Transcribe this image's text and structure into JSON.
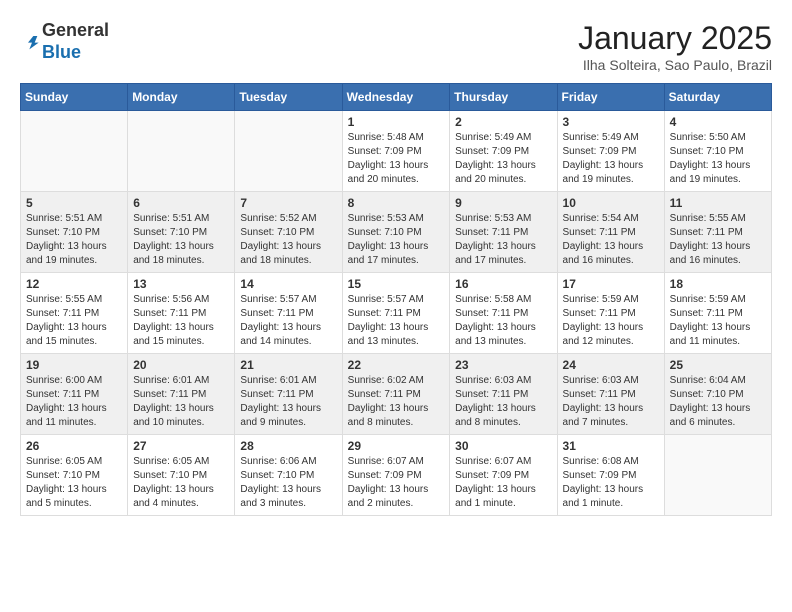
{
  "logo": {
    "general": "General",
    "blue": "Blue"
  },
  "title": "January 2025",
  "subtitle": "Ilha Solteira, Sao Paulo, Brazil",
  "days_of_week": [
    "Sunday",
    "Monday",
    "Tuesday",
    "Wednesday",
    "Thursday",
    "Friday",
    "Saturday"
  ],
  "weeks": [
    {
      "shade": false,
      "days": [
        {
          "number": "",
          "info": ""
        },
        {
          "number": "",
          "info": ""
        },
        {
          "number": "",
          "info": ""
        },
        {
          "number": "1",
          "info": "Sunrise: 5:48 AM\nSunset: 7:09 PM\nDaylight: 13 hours and 20 minutes."
        },
        {
          "number": "2",
          "info": "Sunrise: 5:49 AM\nSunset: 7:09 PM\nDaylight: 13 hours and 20 minutes."
        },
        {
          "number": "3",
          "info": "Sunrise: 5:49 AM\nSunset: 7:09 PM\nDaylight: 13 hours and 19 minutes."
        },
        {
          "number": "4",
          "info": "Sunrise: 5:50 AM\nSunset: 7:10 PM\nDaylight: 13 hours and 19 minutes."
        }
      ]
    },
    {
      "shade": true,
      "days": [
        {
          "number": "5",
          "info": "Sunrise: 5:51 AM\nSunset: 7:10 PM\nDaylight: 13 hours and 19 minutes."
        },
        {
          "number": "6",
          "info": "Sunrise: 5:51 AM\nSunset: 7:10 PM\nDaylight: 13 hours and 18 minutes."
        },
        {
          "number": "7",
          "info": "Sunrise: 5:52 AM\nSunset: 7:10 PM\nDaylight: 13 hours and 18 minutes."
        },
        {
          "number": "8",
          "info": "Sunrise: 5:53 AM\nSunset: 7:10 PM\nDaylight: 13 hours and 17 minutes."
        },
        {
          "number": "9",
          "info": "Sunrise: 5:53 AM\nSunset: 7:11 PM\nDaylight: 13 hours and 17 minutes."
        },
        {
          "number": "10",
          "info": "Sunrise: 5:54 AM\nSunset: 7:11 PM\nDaylight: 13 hours and 16 minutes."
        },
        {
          "number": "11",
          "info": "Sunrise: 5:55 AM\nSunset: 7:11 PM\nDaylight: 13 hours and 16 minutes."
        }
      ]
    },
    {
      "shade": false,
      "days": [
        {
          "number": "12",
          "info": "Sunrise: 5:55 AM\nSunset: 7:11 PM\nDaylight: 13 hours and 15 minutes."
        },
        {
          "number": "13",
          "info": "Sunrise: 5:56 AM\nSunset: 7:11 PM\nDaylight: 13 hours and 15 minutes."
        },
        {
          "number": "14",
          "info": "Sunrise: 5:57 AM\nSunset: 7:11 PM\nDaylight: 13 hours and 14 minutes."
        },
        {
          "number": "15",
          "info": "Sunrise: 5:57 AM\nSunset: 7:11 PM\nDaylight: 13 hours and 13 minutes."
        },
        {
          "number": "16",
          "info": "Sunrise: 5:58 AM\nSunset: 7:11 PM\nDaylight: 13 hours and 13 minutes."
        },
        {
          "number": "17",
          "info": "Sunrise: 5:59 AM\nSunset: 7:11 PM\nDaylight: 13 hours and 12 minutes."
        },
        {
          "number": "18",
          "info": "Sunrise: 5:59 AM\nSunset: 7:11 PM\nDaylight: 13 hours and 11 minutes."
        }
      ]
    },
    {
      "shade": true,
      "days": [
        {
          "number": "19",
          "info": "Sunrise: 6:00 AM\nSunset: 7:11 PM\nDaylight: 13 hours and 11 minutes."
        },
        {
          "number": "20",
          "info": "Sunrise: 6:01 AM\nSunset: 7:11 PM\nDaylight: 13 hours and 10 minutes."
        },
        {
          "number": "21",
          "info": "Sunrise: 6:01 AM\nSunset: 7:11 PM\nDaylight: 13 hours and 9 minutes."
        },
        {
          "number": "22",
          "info": "Sunrise: 6:02 AM\nSunset: 7:11 PM\nDaylight: 13 hours and 8 minutes."
        },
        {
          "number": "23",
          "info": "Sunrise: 6:03 AM\nSunset: 7:11 PM\nDaylight: 13 hours and 8 minutes."
        },
        {
          "number": "24",
          "info": "Sunrise: 6:03 AM\nSunset: 7:11 PM\nDaylight: 13 hours and 7 minutes."
        },
        {
          "number": "25",
          "info": "Sunrise: 6:04 AM\nSunset: 7:10 PM\nDaylight: 13 hours and 6 minutes."
        }
      ]
    },
    {
      "shade": false,
      "days": [
        {
          "number": "26",
          "info": "Sunrise: 6:05 AM\nSunset: 7:10 PM\nDaylight: 13 hours and 5 minutes."
        },
        {
          "number": "27",
          "info": "Sunrise: 6:05 AM\nSunset: 7:10 PM\nDaylight: 13 hours and 4 minutes."
        },
        {
          "number": "28",
          "info": "Sunrise: 6:06 AM\nSunset: 7:10 PM\nDaylight: 13 hours and 3 minutes."
        },
        {
          "number": "29",
          "info": "Sunrise: 6:07 AM\nSunset: 7:09 PM\nDaylight: 13 hours and 2 minutes."
        },
        {
          "number": "30",
          "info": "Sunrise: 6:07 AM\nSunset: 7:09 PM\nDaylight: 13 hours and 1 minute."
        },
        {
          "number": "31",
          "info": "Sunrise: 6:08 AM\nSunset: 7:09 PM\nDaylight: 13 hours and 1 minute."
        },
        {
          "number": "",
          "info": ""
        }
      ]
    }
  ]
}
